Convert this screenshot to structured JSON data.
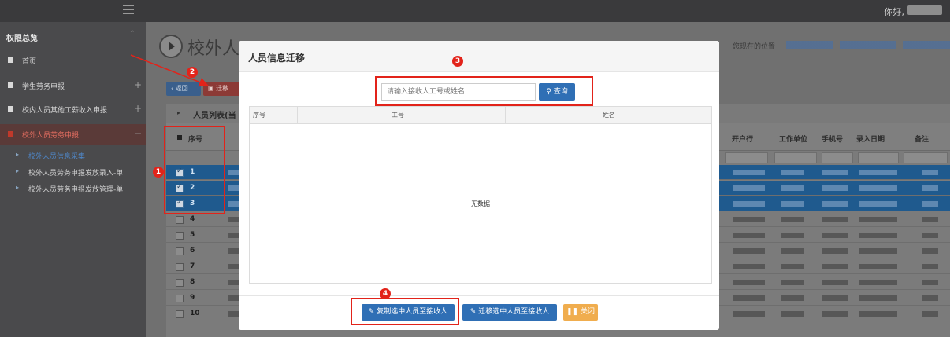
{
  "topbar": {
    "greeting": "你好,"
  },
  "sidebar": {
    "title": "权限总览",
    "items": [
      {
        "label": "首页",
        "has_plus": false,
        "active": false
      },
      {
        "label": "学生劳务申报",
        "has_plus": true,
        "active": false
      },
      {
        "label": "校内人员其他工薪收入申报",
        "has_plus": true,
        "active": false
      },
      {
        "label": "校外人员劳务申报",
        "has_plus": false,
        "active": true
      }
    ],
    "subitems": [
      {
        "label": "校外人员信息采集",
        "current": true
      },
      {
        "label": "校外人员劳务申报发放录入-单",
        "current": false
      },
      {
        "label": "校外人员劳务申报发放管理-单",
        "current": false
      }
    ]
  },
  "page": {
    "title": "校外人",
    "location_label": "您现在的位置",
    "back_label": "返回",
    "migrate_label": "迁移",
    "list_header": "人员列表(当"
  },
  "grid": {
    "headers": {
      "seq": "序号",
      "bank": "开户行",
      "unit": "工作单位",
      "phone": "手机号",
      "entry_date": "录入日期",
      "remark": "备注"
    },
    "rows": [
      {
        "num": "1",
        "selected": true
      },
      {
        "num": "2",
        "selected": true
      },
      {
        "num": "3",
        "selected": true
      },
      {
        "num": "4",
        "selected": false
      },
      {
        "num": "5",
        "selected": false
      },
      {
        "num": "6",
        "selected": false
      },
      {
        "num": "7",
        "selected": false
      },
      {
        "num": "8",
        "selected": false
      },
      {
        "num": "9",
        "selected": false
      },
      {
        "num": "10",
        "selected": false
      }
    ]
  },
  "modal": {
    "title": "人员信息迁移",
    "search_placeholder": "请输入接收人工号或姓名",
    "search_button": "查询",
    "columns": {
      "seq": "序号",
      "emp_no": "工号",
      "name": "姓名"
    },
    "empty_text": "无数据",
    "buttons": {
      "copy": "复制选中人员至接收人",
      "move": "迁移选中人员至接收人",
      "close": "关闭"
    }
  },
  "annotations": {
    "markers": [
      "1",
      "2",
      "3",
      "4"
    ],
    "color": "#e2231a"
  },
  "colors": {
    "primary": "#2f6fb5",
    "warning": "#f0ad4e",
    "selected_row": "#1f5a8e"
  }
}
